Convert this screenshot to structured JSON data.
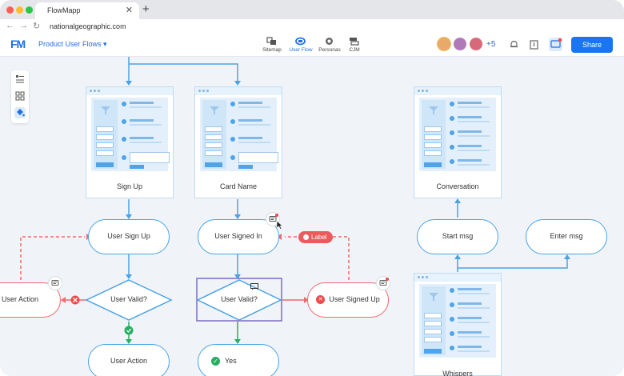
{
  "browser": {
    "tab_title": "FlowMapp",
    "tab_close": "✕",
    "new_tab": "+",
    "url": "nationalgeographic.com",
    "colors": {
      "close": "#ff5f57",
      "minimize": "#febc2e",
      "maximize": "#28c840"
    }
  },
  "app": {
    "logo": "FM",
    "project_name": "Product User Flows",
    "project_caret": "▾",
    "views": [
      {
        "label": "Sitemap",
        "icon": "sitemap-icon",
        "active": false
      },
      {
        "label": "User Flow",
        "icon": "user-flow-icon",
        "active": true
      },
      {
        "label": "Personas",
        "icon": "personas-icon",
        "active": false
      },
      {
        "label": "CJM",
        "icon": "cjm-icon",
        "active": false
      }
    ],
    "collaborators_extra": "+5",
    "share_label": "Share",
    "accent": "#1f6fe5"
  },
  "left_toolbar": [
    "list-icon",
    "grid-icon",
    "paint-bucket-icon"
  ],
  "screens": [
    {
      "label": "Sign Up"
    },
    {
      "label": "Card Name"
    },
    {
      "label": "Conversation"
    },
    {
      "label": "Whispers"
    }
  ],
  "nodes": {
    "user_sign_up": "User Sign Up",
    "user_signed_in": "User Signed In",
    "start_msg": "Start msg",
    "enter_msg": "Enter msg",
    "user_action_left": "User Action",
    "user_valid_1": "User Valid?",
    "user_valid_2": "User Valid?",
    "user_signed_up": "User Signed Up",
    "user_action_bottom": "User Action",
    "yes": "Yes"
  },
  "label_tag": "Label",
  "colors": {
    "flow_blue": "#4aa3e6",
    "error_red": "#f06b6b",
    "success_green": "#27ae60",
    "selection": "#7d6cc4"
  }
}
